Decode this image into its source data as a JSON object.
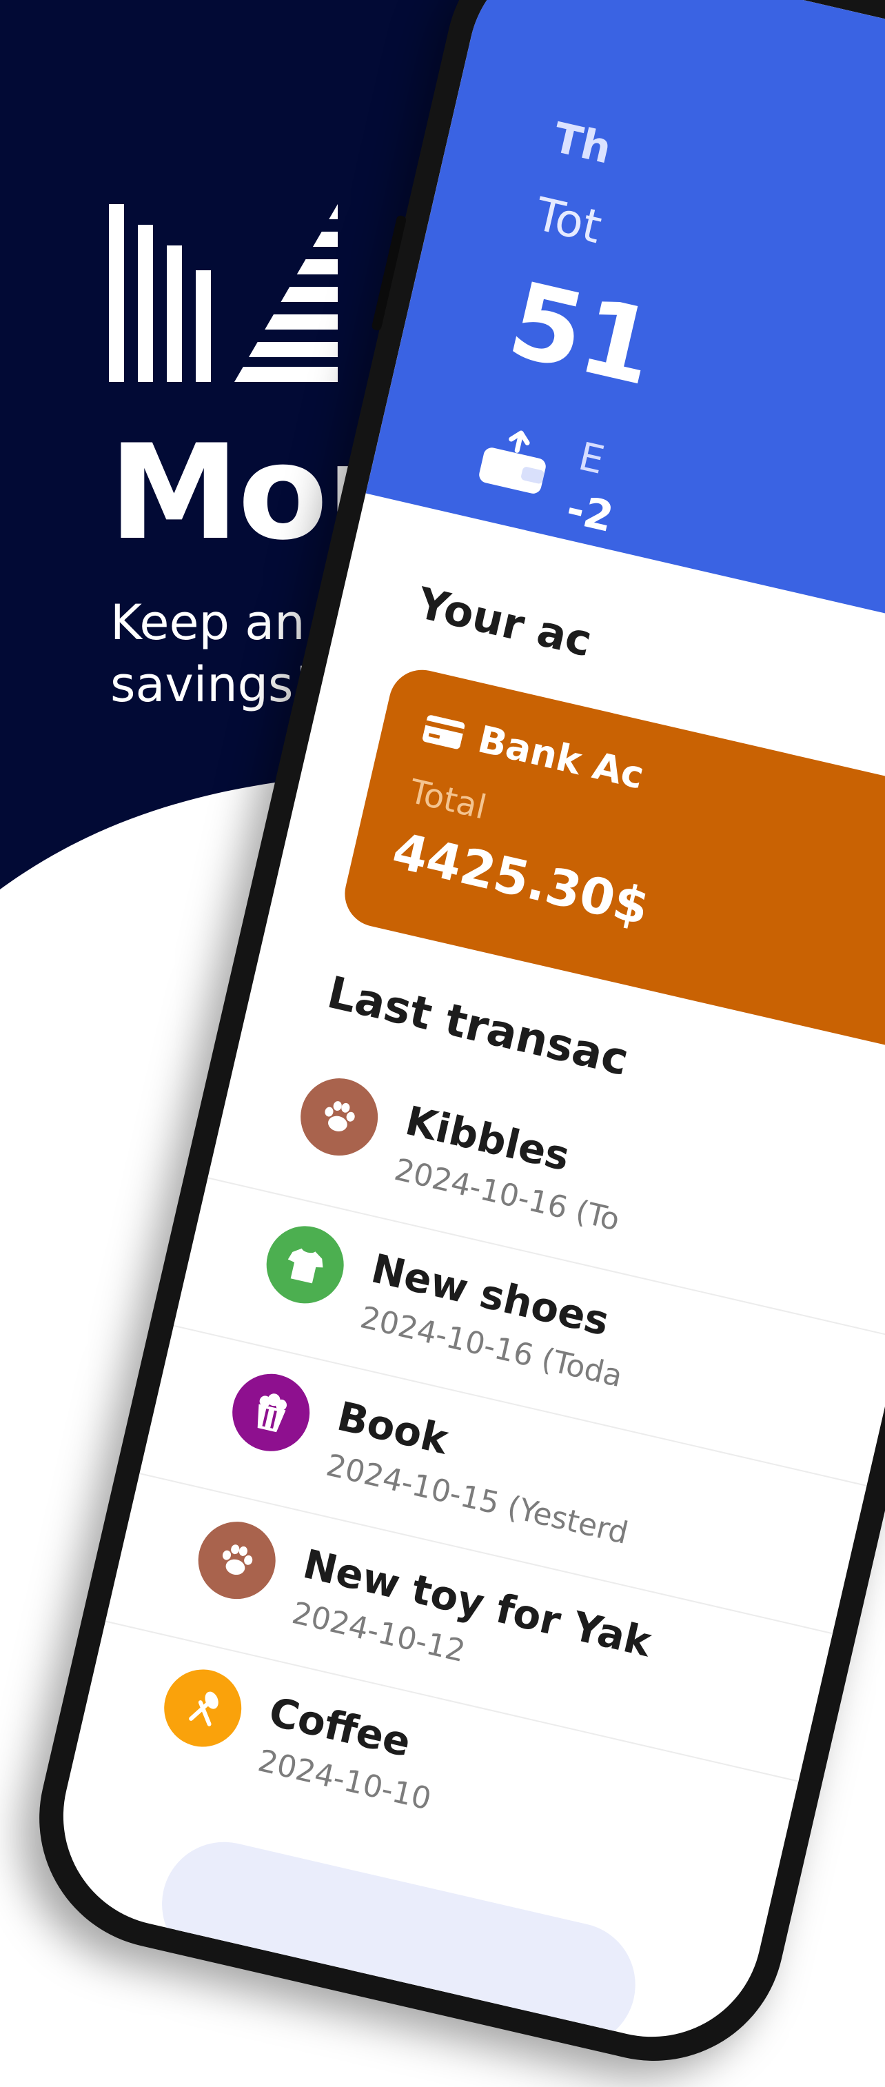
{
  "brand": {
    "name": "Moneye",
    "tagline": "Keep an eye on your savings!",
    "colors": {
      "navy": "#020A35",
      "white": "#FFFFFF"
    }
  },
  "app": {
    "header": {
      "label": "Th",
      "total_label": "Tot",
      "total_value": "51",
      "expense_label": "E",
      "expense_value": "-2",
      "color": "#3A63E3"
    },
    "accounts_title": "Your ac",
    "account_card": {
      "name": "Bank Ac",
      "total_label": "Total",
      "total_value": "4425.30$",
      "color": "#C96203",
      "icon": "credit-card-icon"
    },
    "transactions_title": "Last transac",
    "transactions": [
      {
        "title": "Kibbles",
        "date": "2024-10-16 (To",
        "icon": "paw-icon",
        "color": "#A9634D"
      },
      {
        "title": "New shoes",
        "date": "2024-10-16 (Toda",
        "icon": "tshirt-icon",
        "color": "#4CAF50"
      },
      {
        "title": "Book",
        "date": "2024-10-15 (Yesterd",
        "icon": "popcorn-icon",
        "color": "#8E108F"
      },
      {
        "title": "New toy for Yak",
        "date": "2024-10-12",
        "icon": "paw-icon",
        "color": "#A9634D"
      },
      {
        "title": "Coffee",
        "date": "2024-10-10",
        "icon": "utensils-icon",
        "color": "#FAA20B"
      }
    ]
  }
}
